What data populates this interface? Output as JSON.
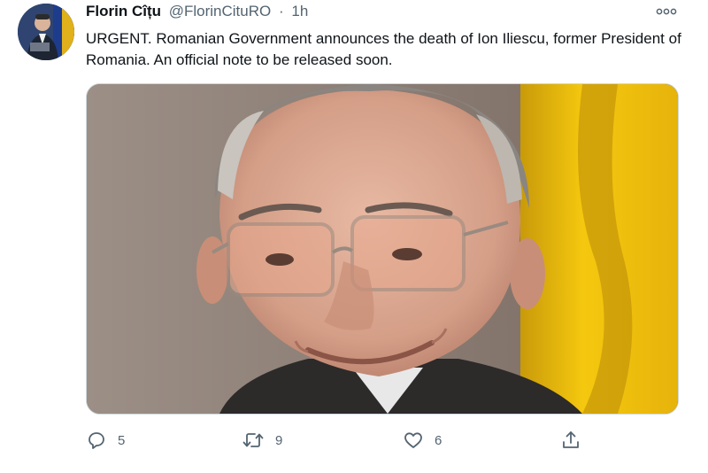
{
  "author": {
    "name": "Florin Cîțu",
    "handle": "@FlorinCituRO",
    "separator": "·",
    "time": "1h"
  },
  "tweet": {
    "text": "URGENT. Romanian Government announces the death of Ion Iliescu, former President of Romania. An official note to be released soon."
  },
  "actions": {
    "replies": "5",
    "retweets": "9",
    "likes": "6"
  },
  "icons": {
    "more": "more-options-icon",
    "reply": "reply-icon",
    "retweet": "retweet-icon",
    "like": "heart-icon",
    "share": "share-icon"
  },
  "colors": {
    "text_primary": "#0f1419",
    "text_secondary": "#536471",
    "flag_yellow": "#f2c20c"
  }
}
